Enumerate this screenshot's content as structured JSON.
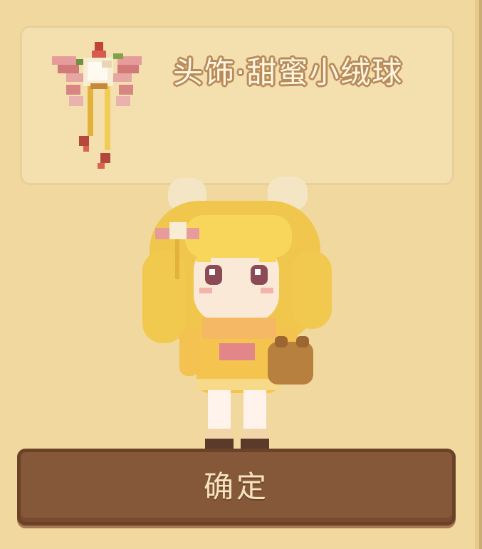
{
  "item": {
    "name": "头饰·甜蜜小绒球",
    "icon": "pink-flower-hair-ornament-icon"
  },
  "character": {
    "sprite": "blonde-girl-yellow-dress-teddy-bear"
  },
  "actions": {
    "confirm_label": "确定"
  },
  "colors": {
    "background": "#f0d89e",
    "card": "#f4e0ae",
    "button": "#85583a",
    "button_text": "#f6e3bf",
    "title_outline": "#b98a5a"
  }
}
